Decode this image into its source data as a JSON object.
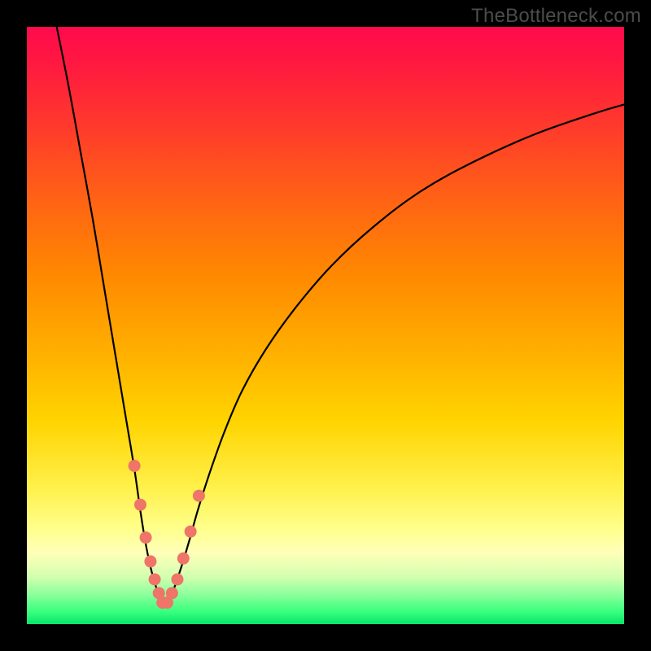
{
  "watermark": "TheBottleneck.com",
  "chart_data": {
    "type": "line",
    "title": "",
    "xlabel": "",
    "ylabel": "",
    "xlim": [
      0,
      100
    ],
    "ylim": [
      0,
      100
    ],
    "series": [
      {
        "name": "left-branch",
        "x": [
          5,
          7,
          9,
          11,
          13,
          15,
          16.5,
          18,
          19,
          19.8,
          20.6,
          21.4,
          22.2,
          22.8
        ],
        "y": [
          100,
          90,
          79,
          68,
          56,
          44,
          35,
          26,
          19,
          14,
          10,
          7,
          4.5,
          3
        ]
      },
      {
        "name": "right-branch",
        "x": [
          23.4,
          24.2,
          25,
          26,
          27.2,
          28.6,
          30.5,
          33,
          36,
          40,
          45,
          51,
          58,
          66,
          75,
          85,
          95,
          100
        ],
        "y": [
          3,
          4.8,
          7,
          10,
          14,
          19,
          25,
          32,
          39,
          46,
          53,
          60,
          66.5,
          72.5,
          77.5,
          82,
          85.5,
          87
        ]
      }
    ],
    "markers": {
      "name": "highlight-dots",
      "x": [
        18.0,
        19.0,
        19.9,
        20.7,
        21.4,
        22.1,
        22.7,
        23.5,
        24.3,
        25.2,
        26.2,
        27.4,
        28.8
      ],
      "y": [
        26.5,
        20.0,
        14.5,
        10.5,
        7.5,
        5.2,
        3.6,
        3.6,
        5.2,
        7.5,
        11.0,
        15.5,
        21.5
      ]
    },
    "gradient_stops": [
      {
        "pct": 0,
        "color": "#ff0a4d"
      },
      {
        "pct": 17,
        "color": "#ff3b2b"
      },
      {
        "pct": 42,
        "color": "#ff8a00"
      },
      {
        "pct": 66,
        "color": "#ffd400"
      },
      {
        "pct": 88,
        "color": "#ffffb8"
      },
      {
        "pct": 100,
        "color": "#07e56a"
      }
    ]
  }
}
